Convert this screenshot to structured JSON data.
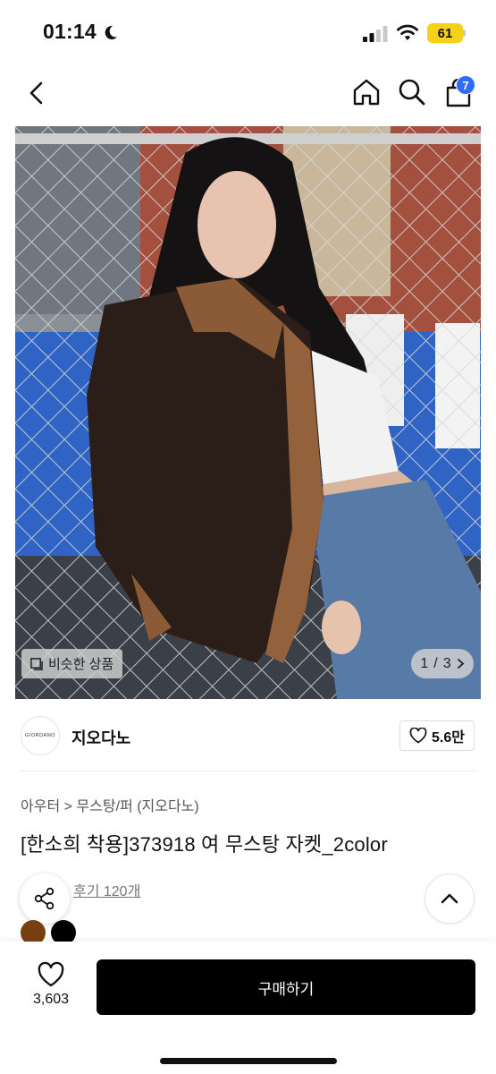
{
  "status_bar": {
    "time": "01:14",
    "battery": "61",
    "colors": {
      "battery": "#f5d11a"
    }
  },
  "nav": {
    "back_icon": "chevron-left-icon",
    "home_icon": "home-icon",
    "search_icon": "search-icon",
    "cart_icon": "shopping-bag-icon",
    "cart_badge": "7",
    "colors": {
      "badge": "#2f6bff"
    }
  },
  "gallery": {
    "similar_label": "비슷한 상품",
    "page_current": "1",
    "page_separator": "/",
    "page_total": "3"
  },
  "brand": {
    "logo_text": "GIORDANO",
    "name": "지오다노",
    "like_count": "5.6만"
  },
  "product": {
    "breadcrumb": [
      "아우터",
      "무스탕/퍼 (지오다노)"
    ],
    "breadcrumb_separator": ">",
    "title": "[한소희 착용]373918 여 무스탕 자켓_2color",
    "review_link": "후기 120개",
    "colors": [
      {
        "name": "brown",
        "hex": "#7a3f10"
      },
      {
        "name": "black",
        "hex": "#000000"
      }
    ]
  },
  "bottom_bar": {
    "wish_count": "3,603",
    "buy_label": "구매하기"
  }
}
